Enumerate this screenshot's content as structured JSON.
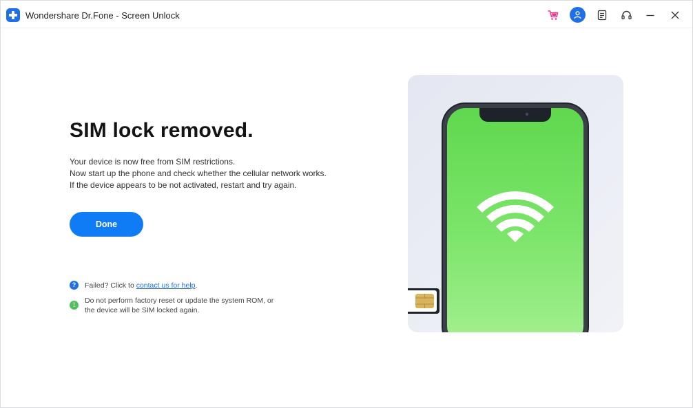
{
  "titlebar": {
    "title": "Wondershare Dr.Fone - Screen Unlock",
    "icons": [
      "app-logo-icon",
      "cart-icon",
      "account-icon",
      "feedback-icon",
      "support-icon",
      "minimize-icon",
      "close-icon"
    ]
  },
  "main": {
    "headline": "SIM lock removed.",
    "description": [
      "Your device is now free from SIM restrictions.",
      "Now start up the phone and check whether the cellular network works.",
      "If the device appears to be not activated, restart and try again."
    ],
    "done_label": "Done",
    "help": {
      "prefix": "Failed? Click to ",
      "link": "contact us for help",
      "suffix": "."
    },
    "warning": [
      "Do not perform factory reset or update the system ROM, or",
      "the device will be SIM locked again."
    ]
  },
  "colors": {
    "accent": "#0f7cf5",
    "brand": "#1f6fe8",
    "success_green": "#4fc25a",
    "screen_green": "#7fe86a",
    "cart_pink": "#e83a8c"
  },
  "illustration": {
    "icons": [
      "phone-icon",
      "wifi-icon",
      "sim-card-icon"
    ]
  }
}
